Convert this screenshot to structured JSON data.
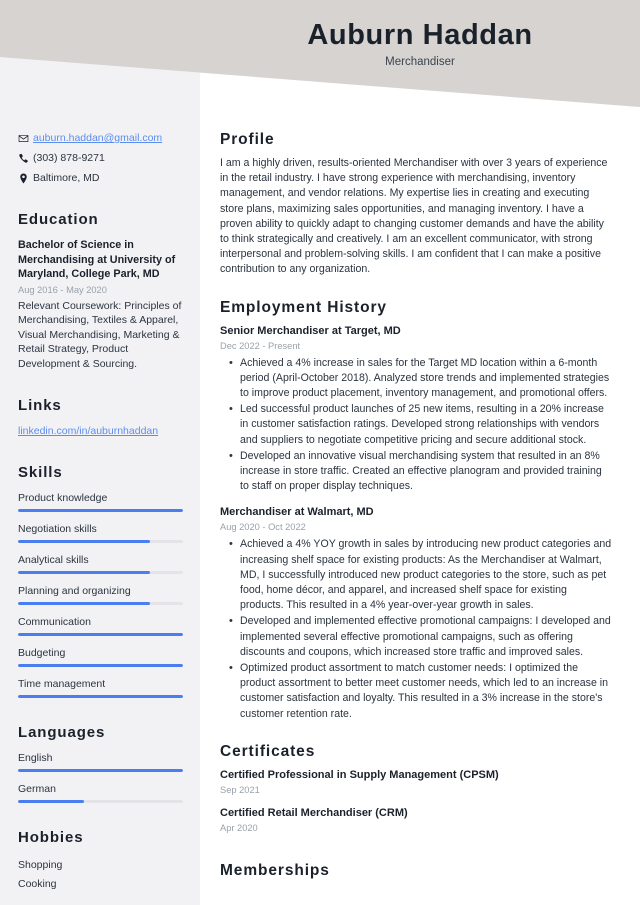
{
  "header": {
    "name": "Auburn Haddan",
    "job_title": "Merchandiser",
    "band_color": "#d6d3d1"
  },
  "colors": {
    "accent": "#4a7ef0",
    "link": "#5b8def",
    "sidebar_bg": "#f2f2f5",
    "text": "#2b3440",
    "muted": "#9aa1ab"
  },
  "sidebar": {
    "contact": [
      {
        "icon": "envelope-icon",
        "value": "auburn.haddan@gmail.com",
        "is_link": true
      },
      {
        "icon": "phone-icon",
        "value": "(303) 878-9271",
        "is_link": false
      },
      {
        "icon": "location-pin-icon",
        "value": "Baltimore, MD",
        "is_link": false
      }
    ],
    "education": {
      "heading": "Education",
      "degree": "Bachelor of Science in Merchandising at University of Maryland, College Park, MD",
      "date": "Aug 2016 - May 2020",
      "description": "Relevant Coursework: Principles of Merchandising, Textiles & Apparel, Visual Merchandising, Marketing & Retail Strategy, Product Development & Sourcing."
    },
    "links": {
      "heading": "Links",
      "items": [
        {
          "label": "linkedin.com/in/auburnhaddan"
        }
      ]
    },
    "skills": {
      "heading": "Skills",
      "items": [
        {
          "label": "Product knowledge",
          "level": 100
        },
        {
          "label": "Negotiation skills",
          "level": 80
        },
        {
          "label": "Analytical skills",
          "level": 80
        },
        {
          "label": "Planning and organizing",
          "level": 80
        },
        {
          "label": "Communication",
          "level": 100
        },
        {
          "label": "Budgeting",
          "level": 100
        },
        {
          "label": "Time management",
          "level": 100
        }
      ]
    },
    "languages": {
      "heading": "Languages",
      "items": [
        {
          "label": "English",
          "level": 100
        },
        {
          "label": "German",
          "level": 40
        }
      ]
    },
    "hobbies": {
      "heading": "Hobbies",
      "items": [
        {
          "label": "Shopping"
        },
        {
          "label": "Cooking"
        }
      ]
    }
  },
  "main": {
    "profile": {
      "heading": "Profile",
      "text": "I am a highly driven, results-oriented Merchandiser with over 3 years of experience in the retail industry. I have strong experience with merchandising, inventory management, and vendor relations. My expertise lies in creating and executing store plans, maximizing sales opportunities, and managing inventory. I have a proven ability to quickly adapt to changing customer demands and have the ability to think strategically and creatively. I am an excellent communicator, with strong interpersonal and problem-solving skills. I am confident that I can make a positive contribution to any organization."
    },
    "employment": {
      "heading": "Employment History",
      "jobs": [
        {
          "title": "Senior Merchandiser at Target, MD",
          "date": "Dec 2022 - Present",
          "bullets": [
            "Achieved a 4% increase in sales for the Target MD location within a 6-month period (April-October 2018). Analyzed store trends and implemented strategies to improve product placement, inventory management, and promotional offers.",
            "Led successful product launches of 25 new items, resulting in a 20% increase in customer satisfaction ratings. Developed strong relationships with vendors and suppliers to negotiate competitive pricing and secure additional stock.",
            "Developed an innovative visual merchandising system that resulted in an 8% increase in store traffic. Created an effective planogram and provided training to staff on proper display techniques."
          ]
        },
        {
          "title": "Merchandiser at Walmart, MD",
          "date": "Aug 2020 - Oct 2022",
          "bullets": [
            "Achieved a 4% YOY growth in sales by introducing new product categories and increasing shelf space for existing products: As the Merchandiser at Walmart, MD, I successfully introduced new product categories to the store, such as pet food, home décor, and apparel, and increased shelf space for existing products. This resulted in a 4% year-over-year growth in sales.",
            "Developed and implemented effective promotional campaigns: I developed and implemented several effective promotional campaigns, such as offering discounts and coupons, which increased store traffic and improved sales.",
            "Optimized product assortment to match customer needs: I optimized the product assortment to better meet customer needs, which led to an increase in customer satisfaction and loyalty. This resulted in a 3% increase in the store's customer retention rate."
          ]
        }
      ]
    },
    "certificates": {
      "heading": "Certificates",
      "items": [
        {
          "name": "Certified Professional in Supply Management (CPSM)",
          "date": "Sep 2021"
        },
        {
          "name": "Certified Retail Merchandiser (CRM)",
          "date": "Apr 2020"
        }
      ]
    },
    "memberships": {
      "heading": "Memberships"
    }
  }
}
